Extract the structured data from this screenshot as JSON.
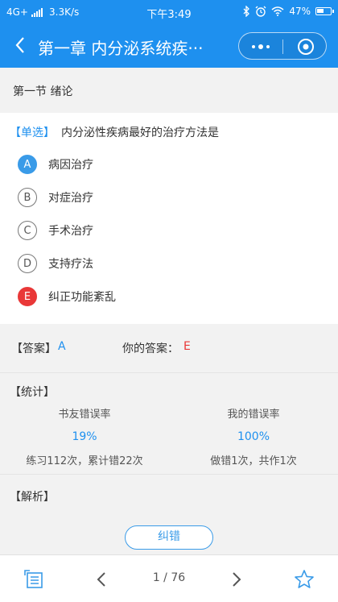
{
  "status_bar": {
    "network": "4G+",
    "speed": "3.3K/s",
    "time": "下午3:49",
    "battery": "47%"
  },
  "nav": {
    "title": "第一章 内分泌系统疾病",
    "title_display": "第一章 内分泌系统疾···",
    "accent_color": "#1e90ef"
  },
  "section": {
    "title": "第一节 绪论"
  },
  "question": {
    "type": "【单选】",
    "text": "内分泌性疾病最好的治疗方法是",
    "options": [
      {
        "letter": "A",
        "text": "病因治疗",
        "state": "correct"
      },
      {
        "letter": "B",
        "text": "对症治疗",
        "state": "normal"
      },
      {
        "letter": "C",
        "text": "手术治疗",
        "state": "normal"
      },
      {
        "letter": "D",
        "text": "支持疗法",
        "state": "normal"
      },
      {
        "letter": "E",
        "text": "纠正功能紊乱",
        "state": "wrong"
      }
    ]
  },
  "answer": {
    "label": "【答案】",
    "value": "A",
    "your_label": "你的答案：",
    "your_value": "E"
  },
  "stats": {
    "label": "【统计】",
    "peer_header": "书友错误率",
    "peer_value": "19%",
    "peer_detail": "练习112次，累计错22次",
    "my_header": "我的错误率",
    "my_value": "100%",
    "my_detail": "做错1次，共作1次"
  },
  "explanation": {
    "label": "【解析】",
    "report_button": "纠错"
  },
  "bottom": {
    "page_indicator": "1 / 76"
  },
  "colors": {
    "correct": "#3a9be8",
    "wrong": "#e93838"
  }
}
